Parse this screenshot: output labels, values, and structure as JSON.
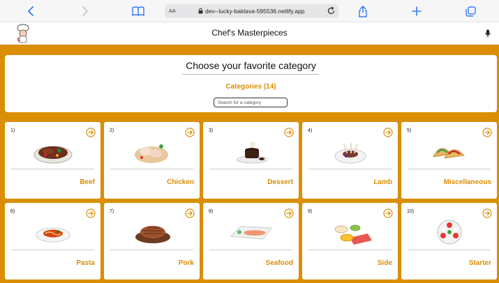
{
  "browser": {
    "url_aa": "AA",
    "url": "dev--lucky-baklava-595536.netlify.app"
  },
  "app": {
    "title": "Chef's Masterpieces"
  },
  "header": {
    "heading": "Choose your favorite category",
    "count_label": "Categories (14)",
    "search_placeholder": "Search for a category"
  },
  "categories": [
    {
      "num": "1)",
      "name": "Beef",
      "icon": "beef-plate-image"
    },
    {
      "num": "2)",
      "name": "Chicken",
      "icon": "chicken-board-image"
    },
    {
      "num": "3)",
      "name": "Dessert",
      "icon": "chocolate-dessert-image"
    },
    {
      "num": "4)",
      "name": "Lamb",
      "icon": "lamb-chops-image"
    },
    {
      "num": "5)",
      "name": "Miscellaneous",
      "icon": "tacos-image"
    },
    {
      "num": "6)",
      "name": "Pasta",
      "icon": "pasta-plate-image"
    },
    {
      "num": "7)",
      "name": "Pork",
      "icon": "pork-roast-image"
    },
    {
      "num": "8)",
      "name": "Seafood",
      "icon": "seafood-plate-image"
    },
    {
      "num": "9)",
      "name": "Side",
      "icon": "side-dishes-image"
    },
    {
      "num": "10)",
      "name": "Starter",
      "icon": "caprese-starter-image"
    }
  ],
  "colors": {
    "accent": "#d98e04",
    "browser_blue": "#3478f6"
  }
}
